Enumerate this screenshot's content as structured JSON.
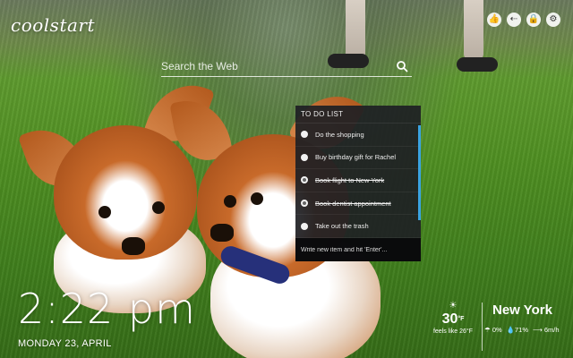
{
  "brand": {
    "logo_text": "coolstart"
  },
  "header": {
    "icons": [
      "thumbs-up-icon",
      "share-icon",
      "lock-icon",
      "gear-icon"
    ]
  },
  "search": {
    "placeholder": "Search the Web"
  },
  "todo": {
    "title": "TO DO LIST",
    "items": [
      {
        "text": "Do the shopping",
        "done": false
      },
      {
        "text": "Buy birthday gift for Rachel",
        "done": false
      },
      {
        "text": "Book flight to New York",
        "done": true
      },
      {
        "text": "Book dentist appointment",
        "done": true
      },
      {
        "text": "Take out the trash",
        "done": false
      }
    ],
    "input_placeholder": "Write new item and hit 'Enter'..."
  },
  "clock": {
    "time": "2:22 pm",
    "date": "MONDAY 23, APRIL"
  },
  "weather": {
    "temperature": "30",
    "unit": "°F",
    "feels_like": "feels like 26°F",
    "city": "New York",
    "precipitation": "0%",
    "humidity": "71%",
    "wind": "6m/h"
  },
  "colors": {
    "accent": "#3aa3e0",
    "panel": "#1e2024"
  }
}
